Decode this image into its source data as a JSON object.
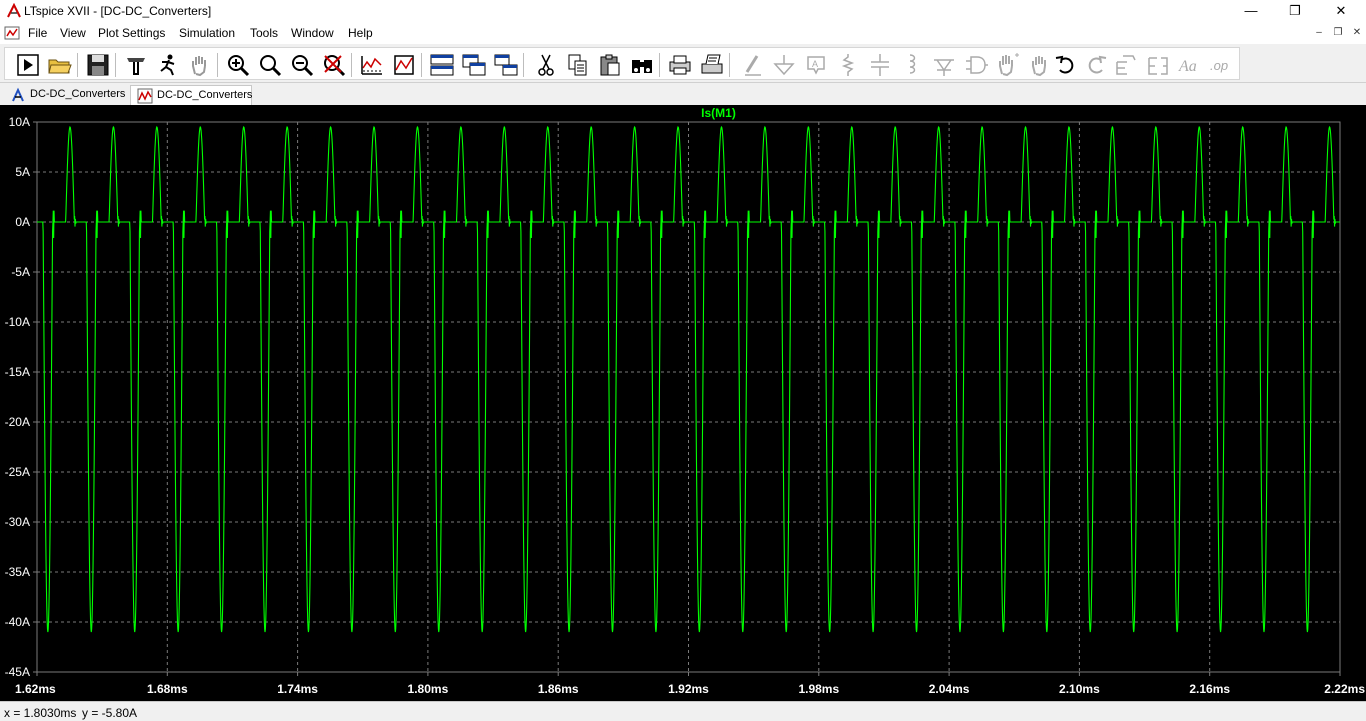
{
  "window": {
    "title": "LTspice XVII - [DC-DC_Converters]",
    "minimize_glyph": "—",
    "maximize_glyph": "❐",
    "close_glyph": "✕"
  },
  "menu": {
    "items": [
      "File",
      "View",
      "Plot Settings",
      "Simulation",
      "Tools",
      "Window",
      "Help"
    ],
    "mdi_minimize": "‒",
    "mdi_restore": "❐",
    "mdi_close": "✕"
  },
  "toolbar": {
    "icons": [
      "run-icon",
      "open-folder-icon",
      "save-icon",
      "control-panel-icon",
      "halt-icon",
      "pan-hand-icon",
      "zoom-in-icon",
      "zoom-area-icon",
      "zoom-out-icon",
      "zoom-full-icon",
      "autorange-icon",
      "attach-cursor-icon",
      "tile-horizontal-icon",
      "cascade-icon",
      "tile-vertical-icon",
      "cut-icon",
      "copy-icon",
      "paste-icon",
      "find-icon",
      "print-icon",
      "print-setup-icon",
      "wire-icon",
      "ground-icon",
      "label-icon",
      "resistor-icon",
      "capacitor-icon",
      "inductor-icon",
      "diode-icon",
      "component-icon",
      "move-icon",
      "drag-icon",
      "undo-icon",
      "redo-icon",
      "rotate-icon",
      "mirror-icon",
      "text-icon",
      "spice-directive-icon"
    ]
  },
  "tabs": [
    {
      "label": "DC-DC_Converters",
      "kind": "schematic"
    },
    {
      "label": "DC-DC_Converters",
      "kind": "waveform"
    }
  ],
  "colors": {
    "plot_background": "#000000",
    "trace": "#00ff00",
    "grid": "#7a7a7a",
    "axis_text": "#ffffff"
  },
  "chart_data": {
    "type": "line",
    "title": "",
    "series": [
      {
        "name": "Is(M1)",
        "color": "#00ff00"
      }
    ],
    "xlabel": "",
    "ylabel": "",
    "x_range_ms": [
      1.62,
      2.22
    ],
    "y_range_A": [
      -45,
      10
    ],
    "x_ticks": [
      "1.62ms",
      "1.68ms",
      "1.74ms",
      "1.80ms",
      "1.86ms",
      "1.92ms",
      "1.98ms",
      "2.04ms",
      "2.10ms",
      "2.16ms",
      "2.22ms"
    ],
    "y_ticks": [
      "10A",
      "5A",
      "0A",
      "-5A",
      "-10A",
      "-15A",
      "-20A",
      "-25A",
      "-30A",
      "-35A",
      "-40A",
      "-45A"
    ],
    "grid": "dashed",
    "waveform": {
      "description": "periodic switching current",
      "period_ms": 0.02,
      "cycles_shown": 30,
      "positive_peak_A": 9.5,
      "negative_peak_A": -41,
      "flat_level_A": 0
    }
  },
  "status": {
    "x_readout": "x = 1.8030ms",
    "y_readout": "y = -5.80A"
  }
}
